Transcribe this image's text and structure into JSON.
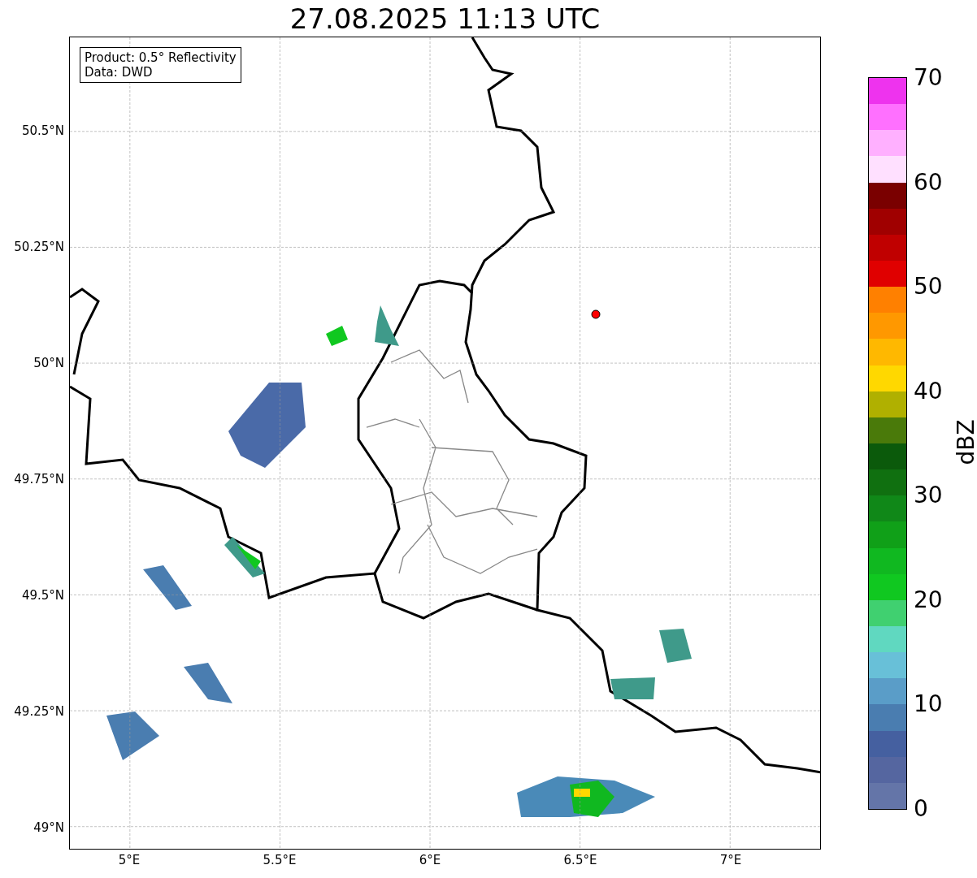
{
  "title": "27.08.2025 11:13 UTC",
  "legend": [
    "Product: 0.5° Reflectivity",
    "Data: DWD"
  ],
  "map": {
    "lat_ticks": [
      "50.5°N",
      "50.25°N",
      "50°N",
      "49.75°N",
      "49.5°N",
      "49.25°N",
      "49°N"
    ],
    "lon_ticks": [
      "5°E",
      "5.5°E",
      "6°E",
      "6.5°E",
      "7°E"
    ]
  },
  "colorbar": {
    "label": "dBZ",
    "ticks": [
      "70",
      "60",
      "50",
      "40",
      "30",
      "20",
      "10",
      "0"
    ],
    "bands": [
      {
        "color": "#ee33ee"
      },
      {
        "color": "#ff70ff"
      },
      {
        "color": "#ffb0ff"
      },
      {
        "color": "#ffe0ff"
      },
      {
        "color": "#7a0000"
      },
      {
        "color": "#a00000"
      },
      {
        "color": "#c00000"
      },
      {
        "color": "#e00000"
      },
      {
        "color": "#ff8000"
      },
      {
        "color": "#ff9800"
      },
      {
        "color": "#ffb800"
      },
      {
        "color": "#ffd800"
      },
      {
        "color": "#b0b000"
      },
      {
        "color": "#4a7a0a"
      },
      {
        "color": "#0b5a0b"
      },
      {
        "color": "#107010"
      },
      {
        "color": "#108818"
      },
      {
        "color": "#10a018"
      },
      {
        "color": "#10b820"
      },
      {
        "color": "#10c820"
      },
      {
        "color": "#40d070"
      },
      {
        "color": "#60d8c0"
      },
      {
        "color": "#68c0d8"
      },
      {
        "color": "#5a9dc8"
      },
      {
        "color": "#4a7db0"
      },
      {
        "color": "#4560a0"
      },
      {
        "color": "#5566a0"
      },
      {
        "color": "#6475a8"
      }
    ]
  }
}
